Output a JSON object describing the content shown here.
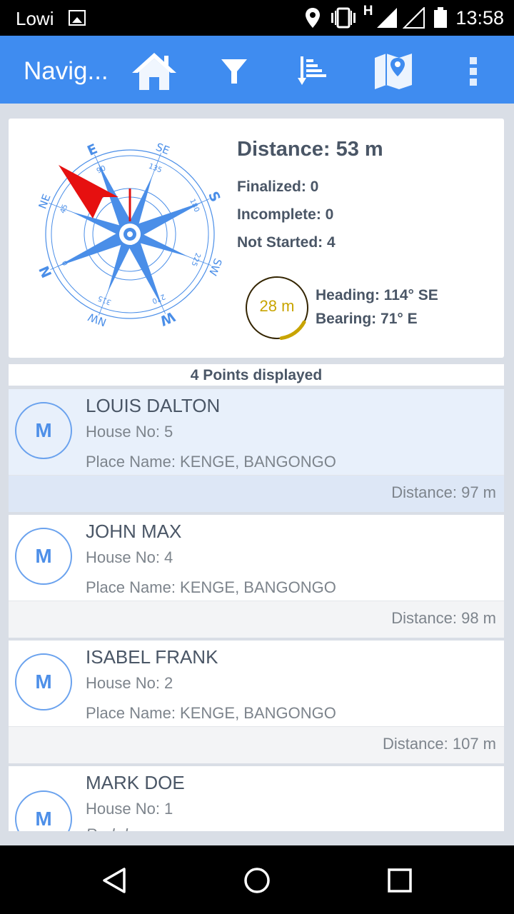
{
  "status_bar": {
    "carrier": "Lowi",
    "network_type": "H",
    "time": "13:58",
    "icons": [
      "image-icon",
      "location-icon",
      "vibrate-icon",
      "signal-icon",
      "signal-empty-icon",
      "battery-icon"
    ]
  },
  "app_bar": {
    "title": "Navig...",
    "actions": [
      "home-icon",
      "filter-icon",
      "sort-icon",
      "map-icon",
      "overflow-menu-icon"
    ],
    "color": "#3f8cf0"
  },
  "navigation": {
    "distance": "Distance: 53 m",
    "finalized": "Finalized: 0",
    "incomplete": "Incomplete: 0",
    "not_started": "Not Started: 4",
    "accuracy": "28 m",
    "accuracy_fraction": 0.15,
    "heading": "Heading: 114° SE",
    "bearing": "Bearing: 71° E",
    "compass": {
      "cardinals": [
        "E",
        "SE",
        "S",
        "SW",
        "W",
        "NW",
        "N",
        "NE"
      ],
      "degrees": [
        "90",
        "135",
        "180",
        "225",
        "270",
        "315",
        "0",
        "45"
      ]
    }
  },
  "points_header": "4 Points displayed",
  "points": [
    {
      "initial": "M",
      "name": "LOUIS DALTON",
      "house": "House No: 5",
      "place": "Place Name: KENGE, BANGONGO",
      "distance": "Distance: 97 m",
      "selected": true
    },
    {
      "initial": "M",
      "name": "JOHN MAX",
      "house": "House No: 4",
      "place": "Place Name: KENGE, BANGONGO",
      "distance": "Distance: 98 m"
    },
    {
      "initial": "M",
      "name": "ISABEL FRANK",
      "house": "House No: 2",
      "place": "Place Name: KENGE, BANGONGO",
      "distance": "Distance: 107 m"
    },
    {
      "initial": "M",
      "name": "MARK DOE",
      "house": "House No: 1",
      "extra": "Red door"
    }
  ],
  "nav_bar": [
    "back-icon",
    "home-circle-icon",
    "recents-icon"
  ]
}
